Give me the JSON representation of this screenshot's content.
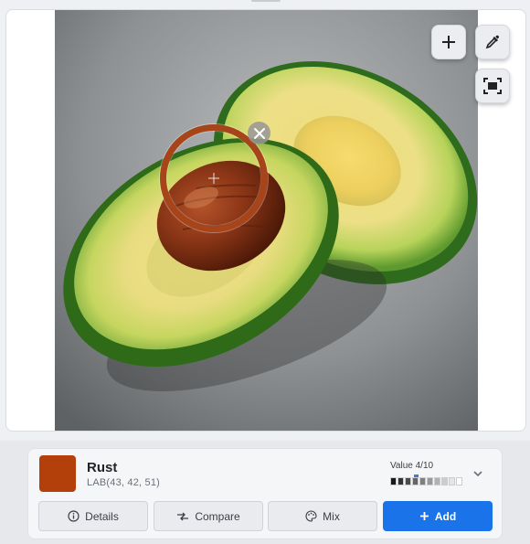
{
  "toolbar": {
    "add_icon": "plus-icon",
    "eyedropper_icon": "eyedropper-icon",
    "fit_icon": "fit-screen-icon"
  },
  "picker": {
    "close_icon": "close-icon",
    "ring_color": "#a7441a"
  },
  "color": {
    "name": "Rust",
    "lab": "LAB(43, 42, 51)",
    "swatch_hex": "#b33f0a",
    "value_label": "Value 4/10",
    "value_level": 4,
    "value_max": 10
  },
  "actions": {
    "details_label": "Details",
    "compare_label": "Compare",
    "mix_label": "Mix",
    "add_label": "Add"
  },
  "colors": {
    "accent": "#1a73e8"
  }
}
